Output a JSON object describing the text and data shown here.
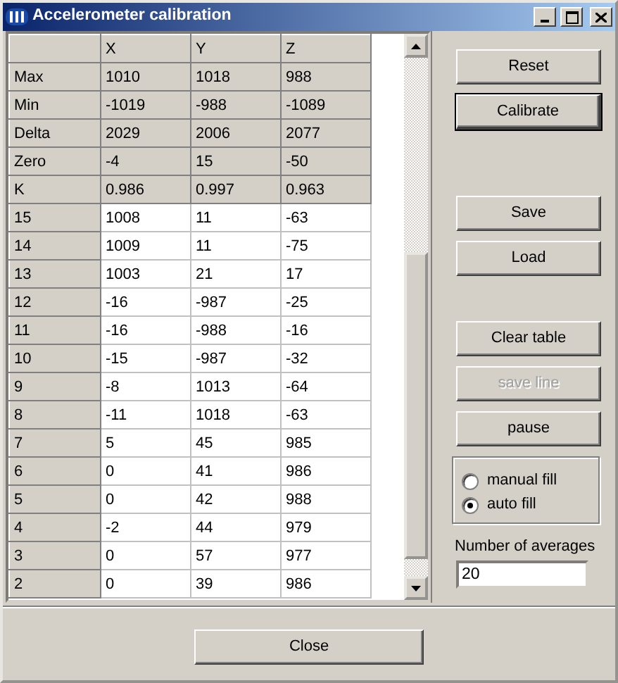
{
  "window": {
    "title": "Accelerometer calibration"
  },
  "table": {
    "columns": [
      "X",
      "Y",
      "Z"
    ],
    "summary_rows": [
      {
        "label": "Max",
        "values": [
          "1010",
          "1018",
          "988"
        ]
      },
      {
        "label": "Min",
        "values": [
          "-1019",
          "-988",
          "-1089"
        ]
      },
      {
        "label": "Delta",
        "values": [
          "2029",
          "2006",
          "2077"
        ]
      },
      {
        "label": "Zero",
        "values": [
          "-4",
          "15",
          "-50"
        ]
      },
      {
        "label": "K",
        "values": [
          "0.986",
          "0.997",
          "0.963"
        ]
      }
    ],
    "rows": [
      {
        "label": "15",
        "values": [
          "1008",
          "11",
          "-63"
        ]
      },
      {
        "label": "14",
        "values": [
          "1009",
          "11",
          "-75"
        ]
      },
      {
        "label": "13",
        "values": [
          "1003",
          "21",
          "17"
        ]
      },
      {
        "label": "12",
        "values": [
          "-16",
          "-987",
          "-25"
        ]
      },
      {
        "label": "11",
        "values": [
          "-16",
          "-988",
          "-16"
        ]
      },
      {
        "label": "10",
        "values": [
          "-15",
          "-987",
          "-32"
        ]
      },
      {
        "label": "9",
        "values": [
          "-8",
          "1013",
          "-64"
        ]
      },
      {
        "label": "8",
        "values": [
          "-11",
          "1018",
          "-63"
        ]
      },
      {
        "label": "7",
        "values": [
          "5",
          "45",
          "985"
        ]
      },
      {
        "label": "6",
        "values": [
          "0",
          "41",
          "986"
        ]
      },
      {
        "label": "5",
        "values": [
          "0",
          "42",
          "988"
        ]
      },
      {
        "label": "4",
        "values": [
          "-2",
          "44",
          "979"
        ]
      },
      {
        "label": "3",
        "values": [
          "0",
          "57",
          "977"
        ]
      },
      {
        "label": "2",
        "values": [
          "0",
          "39",
          "986"
        ]
      }
    ]
  },
  "button_groups": [
    [
      {
        "label": "Reset",
        "default": false,
        "disabled": false
      },
      {
        "label": "Calibrate",
        "default": true,
        "disabled": false
      }
    ],
    [
      {
        "label": "Save",
        "default": false,
        "disabled": false
      },
      {
        "label": "Load",
        "default": false,
        "disabled": false
      }
    ],
    [
      {
        "label": "Clear table",
        "default": false,
        "disabled": false
      },
      {
        "label": "save line",
        "default": false,
        "disabled": true
      },
      {
        "label": "pause",
        "default": false,
        "disabled": false
      }
    ]
  ],
  "fill_mode": [
    {
      "label": "manual fill",
      "selected": false
    },
    {
      "label": "auto fill",
      "selected": true
    }
  ],
  "averages": {
    "label": "Number of averages",
    "value": "20"
  },
  "close_button": {
    "label": "Close"
  }
}
